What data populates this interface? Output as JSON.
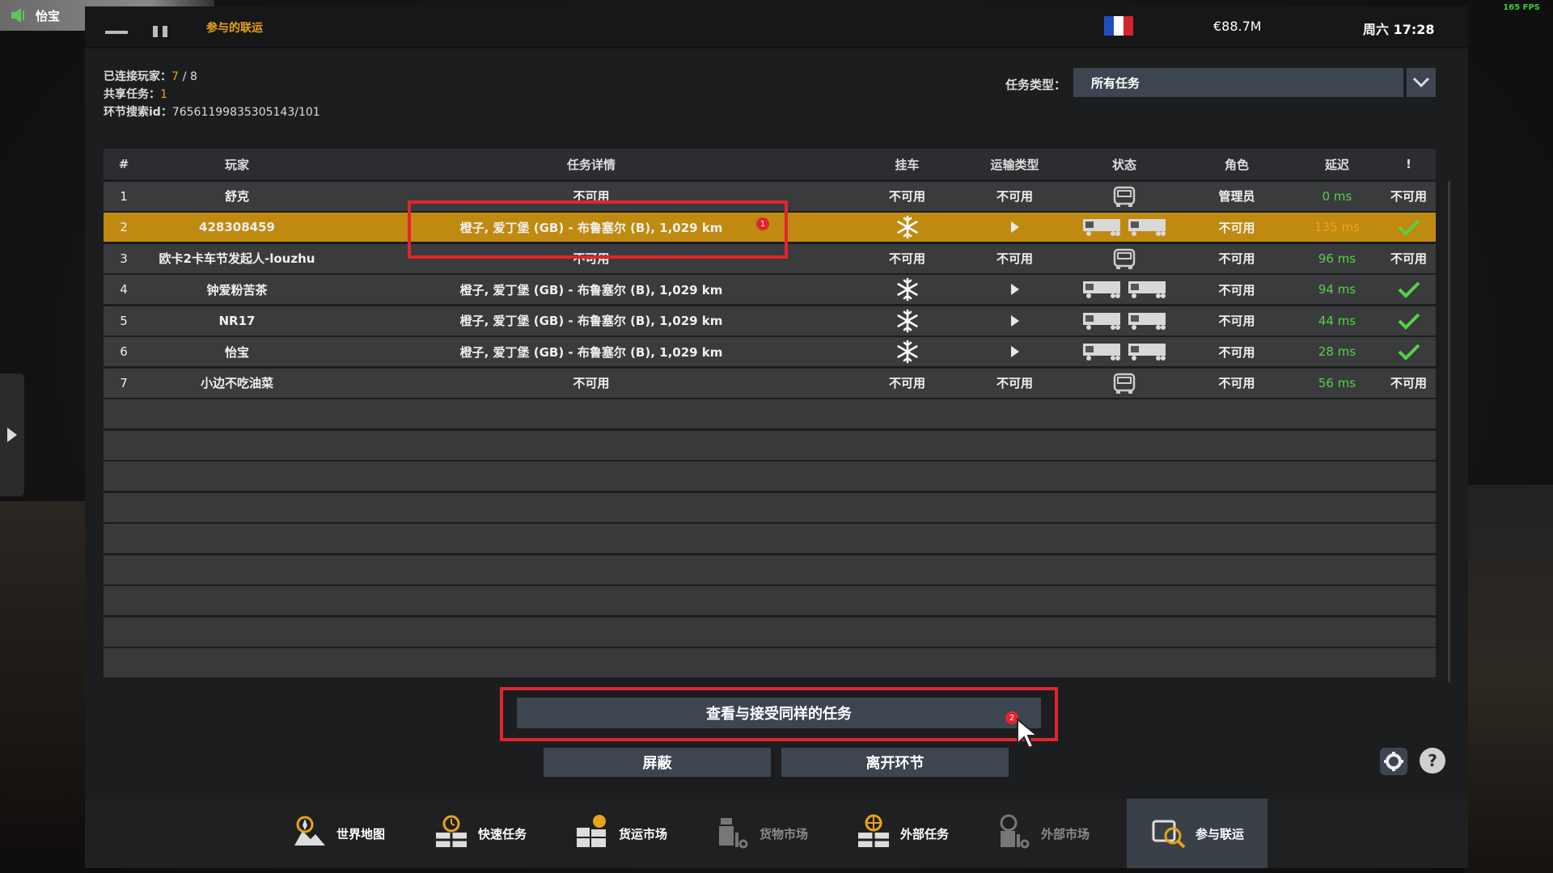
{
  "voice": {
    "name": "怡宝"
  },
  "fps": "165 FPS",
  "topbar": {
    "breadcrumb": "参与的联运",
    "money": "€88.7M",
    "time": "周六 17:28"
  },
  "info": {
    "connected_label": "已连接玩家：",
    "connected_value": "7",
    "connected_sep": "/ 8",
    "shared_label": "共享任务：",
    "shared_value": "1",
    "session_label": "环节搜索id：",
    "session_value": "76561199835305143/101"
  },
  "filter": {
    "label": "任务类型：",
    "value": "所有任务"
  },
  "table": {
    "headers": {
      "num": "#",
      "player": "玩家",
      "detail": "任务详情",
      "trailer": "挂车",
      "transport": "运输类型",
      "status": "状态",
      "role": "角色",
      "ping": "延迟",
      "flag": "!"
    },
    "rows": [
      {
        "num": "1",
        "player": "舒克",
        "detail": "不可用",
        "trailer": "不可用",
        "transport": "不可用",
        "status": "truck",
        "role": "管理员",
        "ping": "0 ms",
        "ping_color": "green",
        "flag": "不可用"
      },
      {
        "num": "2",
        "player": "428308459",
        "detail": "橙子, 爱丁堡 (GB) - 布鲁塞尔 (B), 1,029 km",
        "trailer": "snowflake",
        "transport": "play",
        "status": "trailers",
        "role": "不可用",
        "ping": "135 ms",
        "ping_color": "orange",
        "flag": "check",
        "selected": true
      },
      {
        "num": "3",
        "player": "欧卡2卡车节发起人-louzhu",
        "detail": "不可用",
        "trailer": "不可用",
        "transport": "不可用",
        "status": "truck",
        "role": "不可用",
        "ping": "96 ms",
        "ping_color": "green",
        "flag": "不可用"
      },
      {
        "num": "4",
        "player": "钟爱粉苦茶",
        "detail": "橙子, 爱丁堡 (GB) - 布鲁塞尔 (B), 1,029 km",
        "trailer": "snowflake",
        "transport": "play",
        "status": "trailers",
        "role": "不可用",
        "ping": "94 ms",
        "ping_color": "green",
        "flag": "check"
      },
      {
        "num": "5",
        "player": "NR17",
        "detail": "橙子, 爱丁堡 (GB) - 布鲁塞尔 (B), 1,029 km",
        "trailer": "snowflake",
        "transport": "play",
        "status": "trailers",
        "role": "不可用",
        "ping": "44 ms",
        "ping_color": "green",
        "flag": "check"
      },
      {
        "num": "6",
        "player": "怡宝",
        "detail": "橙子, 爱丁堡 (GB) - 布鲁塞尔 (B), 1,029 km",
        "trailer": "snowflake",
        "transport": "play",
        "status": "trailers",
        "role": "不可用",
        "ping": "28 ms",
        "ping_color": "green",
        "flag": "check"
      },
      {
        "num": "7",
        "player": "小边不吃油菜",
        "detail": "不可用",
        "trailer": "不可用",
        "transport": "不可用",
        "status": "truck",
        "role": "不可用",
        "ping": "56 ms",
        "ping_color": "green",
        "flag": "不可用"
      }
    ]
  },
  "annotations": {
    "badge1": "1",
    "badge2": "2"
  },
  "actions": {
    "view_accept": "查看与接受同样的任务",
    "block": "屏蔽",
    "leave": "离开环节"
  },
  "nav": [
    {
      "label": "世界地图",
      "icon": "map-icon"
    },
    {
      "label": "快速任务",
      "icon": "quick-job-icon"
    },
    {
      "label": "货运市场",
      "icon": "freight-market-icon"
    },
    {
      "label": "货物市场",
      "icon": "cargo-market-icon"
    },
    {
      "label": "外部任务",
      "icon": "external-jobs-icon"
    },
    {
      "label": "外部市场",
      "icon": "external-market-icon"
    },
    {
      "label": "参与联运",
      "icon": "convoy-icon"
    }
  ],
  "colors": {
    "accent": "#e8a317",
    "selected_row": "#c08a10",
    "ping_green": "#58d04a",
    "ping_orange": "#f3a020",
    "highlight_red": "#e1252d"
  }
}
